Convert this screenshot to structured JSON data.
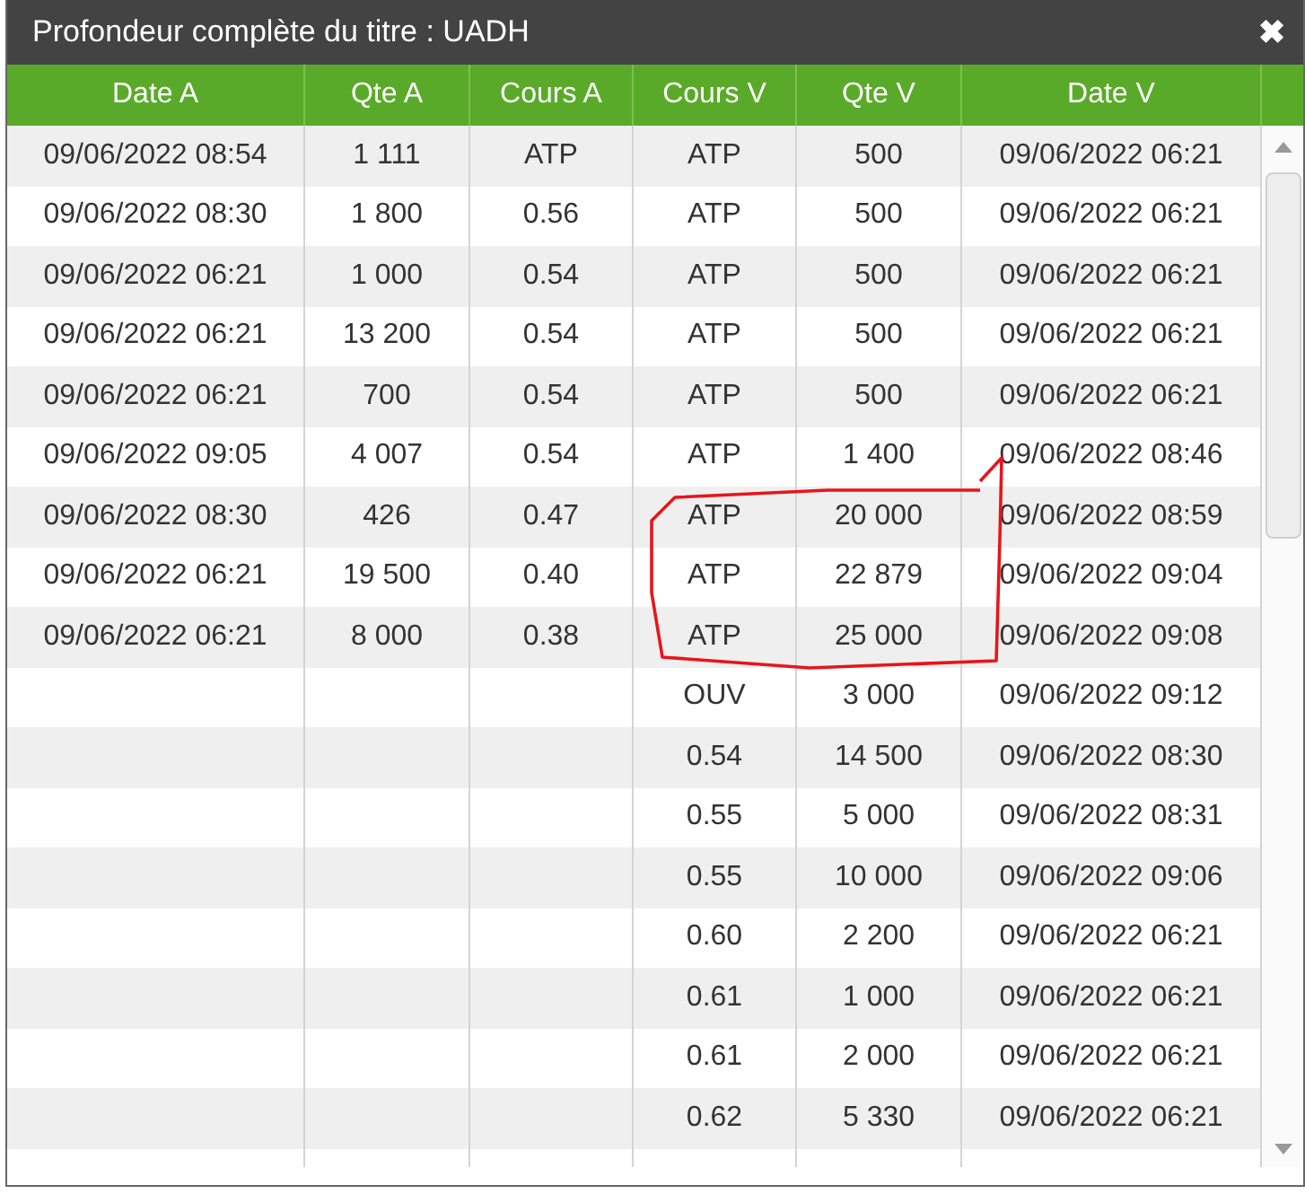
{
  "window": {
    "title": "Profondeur complète du titre : UADH",
    "close": "✖"
  },
  "table": {
    "columns": [
      "Date A",
      "Qte A",
      "Cours A",
      "Cours V",
      "Qte V",
      "Date V"
    ],
    "rows": [
      {
        "date_a": "09/06/2022 08:54",
        "qte_a": "1 111",
        "cours_a": "ATP",
        "cours_v": "ATP",
        "qte_v": "500",
        "date_v": "09/06/2022 06:21"
      },
      {
        "date_a": "09/06/2022 08:30",
        "qte_a": "1 800",
        "cours_a": "0.56",
        "cours_v": "ATP",
        "qte_v": "500",
        "date_v": "09/06/2022 06:21"
      },
      {
        "date_a": "09/06/2022 06:21",
        "qte_a": "1 000",
        "cours_a": "0.54",
        "cours_v": "ATP",
        "qte_v": "500",
        "date_v": "09/06/2022 06:21"
      },
      {
        "date_a": "09/06/2022 06:21",
        "qte_a": "13 200",
        "cours_a": "0.54",
        "cours_v": "ATP",
        "qte_v": "500",
        "date_v": "09/06/2022 06:21"
      },
      {
        "date_a": "09/06/2022 06:21",
        "qte_a": "700",
        "cours_a": "0.54",
        "cours_v": "ATP",
        "qte_v": "500",
        "date_v": "09/06/2022 06:21"
      },
      {
        "date_a": "09/06/2022 09:05",
        "qte_a": "4 007",
        "cours_a": "0.54",
        "cours_v": "ATP",
        "qte_v": "1 400",
        "date_v": "09/06/2022 08:46"
      },
      {
        "date_a": "09/06/2022 08:30",
        "qte_a": "426",
        "cours_a": "0.47",
        "cours_v": "ATP",
        "qte_v": "20 000",
        "date_v": "09/06/2022 08:59"
      },
      {
        "date_a": "09/06/2022 06:21",
        "qte_a": "19 500",
        "cours_a": "0.40",
        "cours_v": "ATP",
        "qte_v": "22 879",
        "date_v": "09/06/2022 09:04"
      },
      {
        "date_a": "09/06/2022 06:21",
        "qte_a": "8 000",
        "cours_a": "0.38",
        "cours_v": "ATP",
        "qte_v": "25 000",
        "date_v": "09/06/2022 09:08"
      },
      {
        "cours_v": "OUV",
        "qte_v": "3 000",
        "date_v": "09/06/2022 09:12"
      },
      {
        "cours_v": "0.54",
        "qte_v": "14 500",
        "date_v": "09/06/2022 08:30"
      },
      {
        "cours_v": "0.55",
        "qte_v": "5 000",
        "date_v": "09/06/2022 08:31"
      },
      {
        "cours_v": "0.55",
        "qte_v": "10 000",
        "date_v": "09/06/2022 09:06"
      },
      {
        "cours_v": "0.60",
        "qte_v": "2 200",
        "date_v": "09/06/2022 06:21"
      },
      {
        "cours_v": "0.61",
        "qte_v": "1 000",
        "date_v": "09/06/2022 06:21"
      },
      {
        "cours_v": "0.61",
        "qte_v": "2 000",
        "date_v": "09/06/2022 06:21"
      },
      {
        "cours_v": "0.62",
        "qte_v": "5 330",
        "date_v": "09/06/2022 06:21"
      }
    ]
  }
}
